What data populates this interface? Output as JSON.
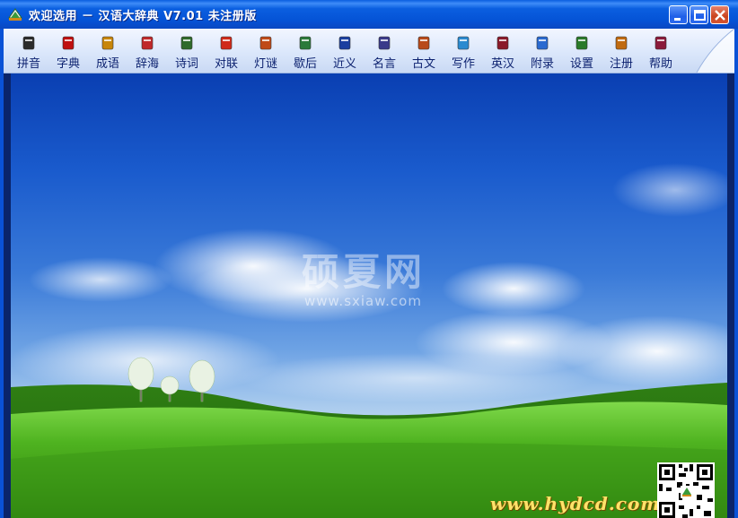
{
  "window": {
    "title": "欢迎选用 － 汉语大辞典 V7.01 未注册版",
    "buttons": {
      "minimize": "minimize",
      "maximize": "maximize",
      "close": "close"
    }
  },
  "toolbar": {
    "items": [
      {
        "label": "拼音",
        "icon": "pinyin-face-icon",
        "color": "#2b2b2b"
      },
      {
        "label": "字典",
        "icon": "dictionary-book-icon",
        "color": "#c01010"
      },
      {
        "label": "成语",
        "icon": "idiom-icon",
        "color": "#c8860a"
      },
      {
        "label": "辞海",
        "icon": "cihai-books-icon",
        "color": "#c0282a"
      },
      {
        "label": "诗词",
        "icon": "poetry-icon",
        "color": "#2f6a2a"
      },
      {
        "label": "对联",
        "icon": "couplet-icon",
        "color": "#d02a1a"
      },
      {
        "label": "灯谜",
        "icon": "lantern-riddle-icon",
        "color": "#c04a18"
      },
      {
        "label": "歇后",
        "icon": "xiehou-icon",
        "color": "#2b7a3a"
      },
      {
        "label": "近义",
        "icon": "synonym-book-icon",
        "color": "#1a3fa0"
      },
      {
        "label": "名言",
        "icon": "quote-icon",
        "color": "#3a3a8a"
      },
      {
        "label": "古文",
        "icon": "ancient-text-icon",
        "color": "#b84a1a"
      },
      {
        "label": "写作",
        "icon": "writing-icon",
        "color": "#2a8ad0"
      },
      {
        "label": "英汉",
        "icon": "english-chinese-icon",
        "color": "#8a1a2a"
      },
      {
        "label": "附录",
        "icon": "appendix-icon",
        "color": "#2a6ad0"
      },
      {
        "label": "设置",
        "icon": "settings-gear-icon",
        "color": "#2a7a2a"
      },
      {
        "label": "注册",
        "icon": "register-icon",
        "color": "#c06a10"
      },
      {
        "label": "帮助",
        "icon": "help-book-icon",
        "color": "#8a1a3a"
      }
    ]
  },
  "content": {
    "watermark_text": "硕夏网",
    "watermark_url": "www.sxiaw.com",
    "site_url": "www.hydcd.com"
  }
}
